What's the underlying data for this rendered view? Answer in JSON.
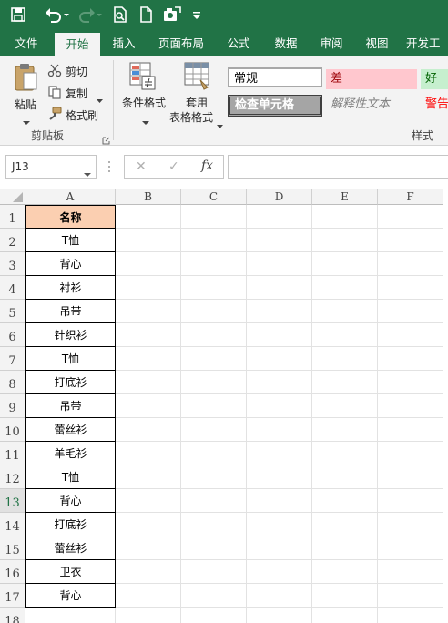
{
  "quick_access": {
    "icons": [
      "save-icon",
      "undo-icon",
      "undo-dropdown-icon",
      "redo-icon",
      "redo-dropdown-icon",
      "print-preview-icon",
      "new-document-icon",
      "camera-icon",
      "customize-toolbar-icon"
    ]
  },
  "tabs": [
    {
      "label": "文件"
    },
    {
      "label": "开始"
    },
    {
      "label": "插入"
    },
    {
      "label": "页面布局"
    },
    {
      "label": "公式"
    },
    {
      "label": "数据"
    },
    {
      "label": "审阅"
    },
    {
      "label": "视图"
    },
    {
      "label": "开发工"
    }
  ],
  "ribbon": {
    "clipboard": {
      "paste": "粘贴",
      "cut": "剪切",
      "copy": "复制",
      "format_painter": "格式刷",
      "group_label": "剪贴板"
    },
    "conditional_format": "条件格式",
    "table_format_line1": "套用",
    "table_format_line2": "表格格式",
    "styles": {
      "normal": "常规",
      "bad": "差",
      "good": "好",
      "check_cell": "检查单元格",
      "explanatory": "解释性文本",
      "warning": "警告",
      "group_label": "样式"
    }
  },
  "formula_bar": {
    "name_box": "J13",
    "cancel_icon": "✕",
    "enter_icon": "✓",
    "fx_label": "fx",
    "formula_value": ""
  },
  "sheet": {
    "columns": [
      "A",
      "B",
      "C",
      "D",
      "E",
      "F"
    ],
    "rows": [
      "1",
      "2",
      "3",
      "4",
      "5",
      "6",
      "7",
      "8",
      "9",
      "10",
      "11",
      "12",
      "13",
      "14",
      "15",
      "16",
      "17",
      "18"
    ],
    "header_cell": "名称",
    "values": [
      "T恤",
      "背心",
      "衬衫",
      "吊带",
      "针织衫",
      "T恤",
      "打底衫",
      "吊带",
      "蕾丝衫",
      "羊毛衫",
      "T恤",
      "背心",
      "打底衫",
      "蕾丝衫",
      "卫衣",
      "背心"
    ],
    "header_fill": "#fbcfb1",
    "active_row": "13"
  },
  "colors": {
    "brand_green": "#217346",
    "bad_fill": "#ffc7ce",
    "bad_text": "#9c0006",
    "good_fill": "#c6efce",
    "good_text": "#006100",
    "check_fill": "#a5a5a5",
    "warning_text": "#ff0000"
  }
}
